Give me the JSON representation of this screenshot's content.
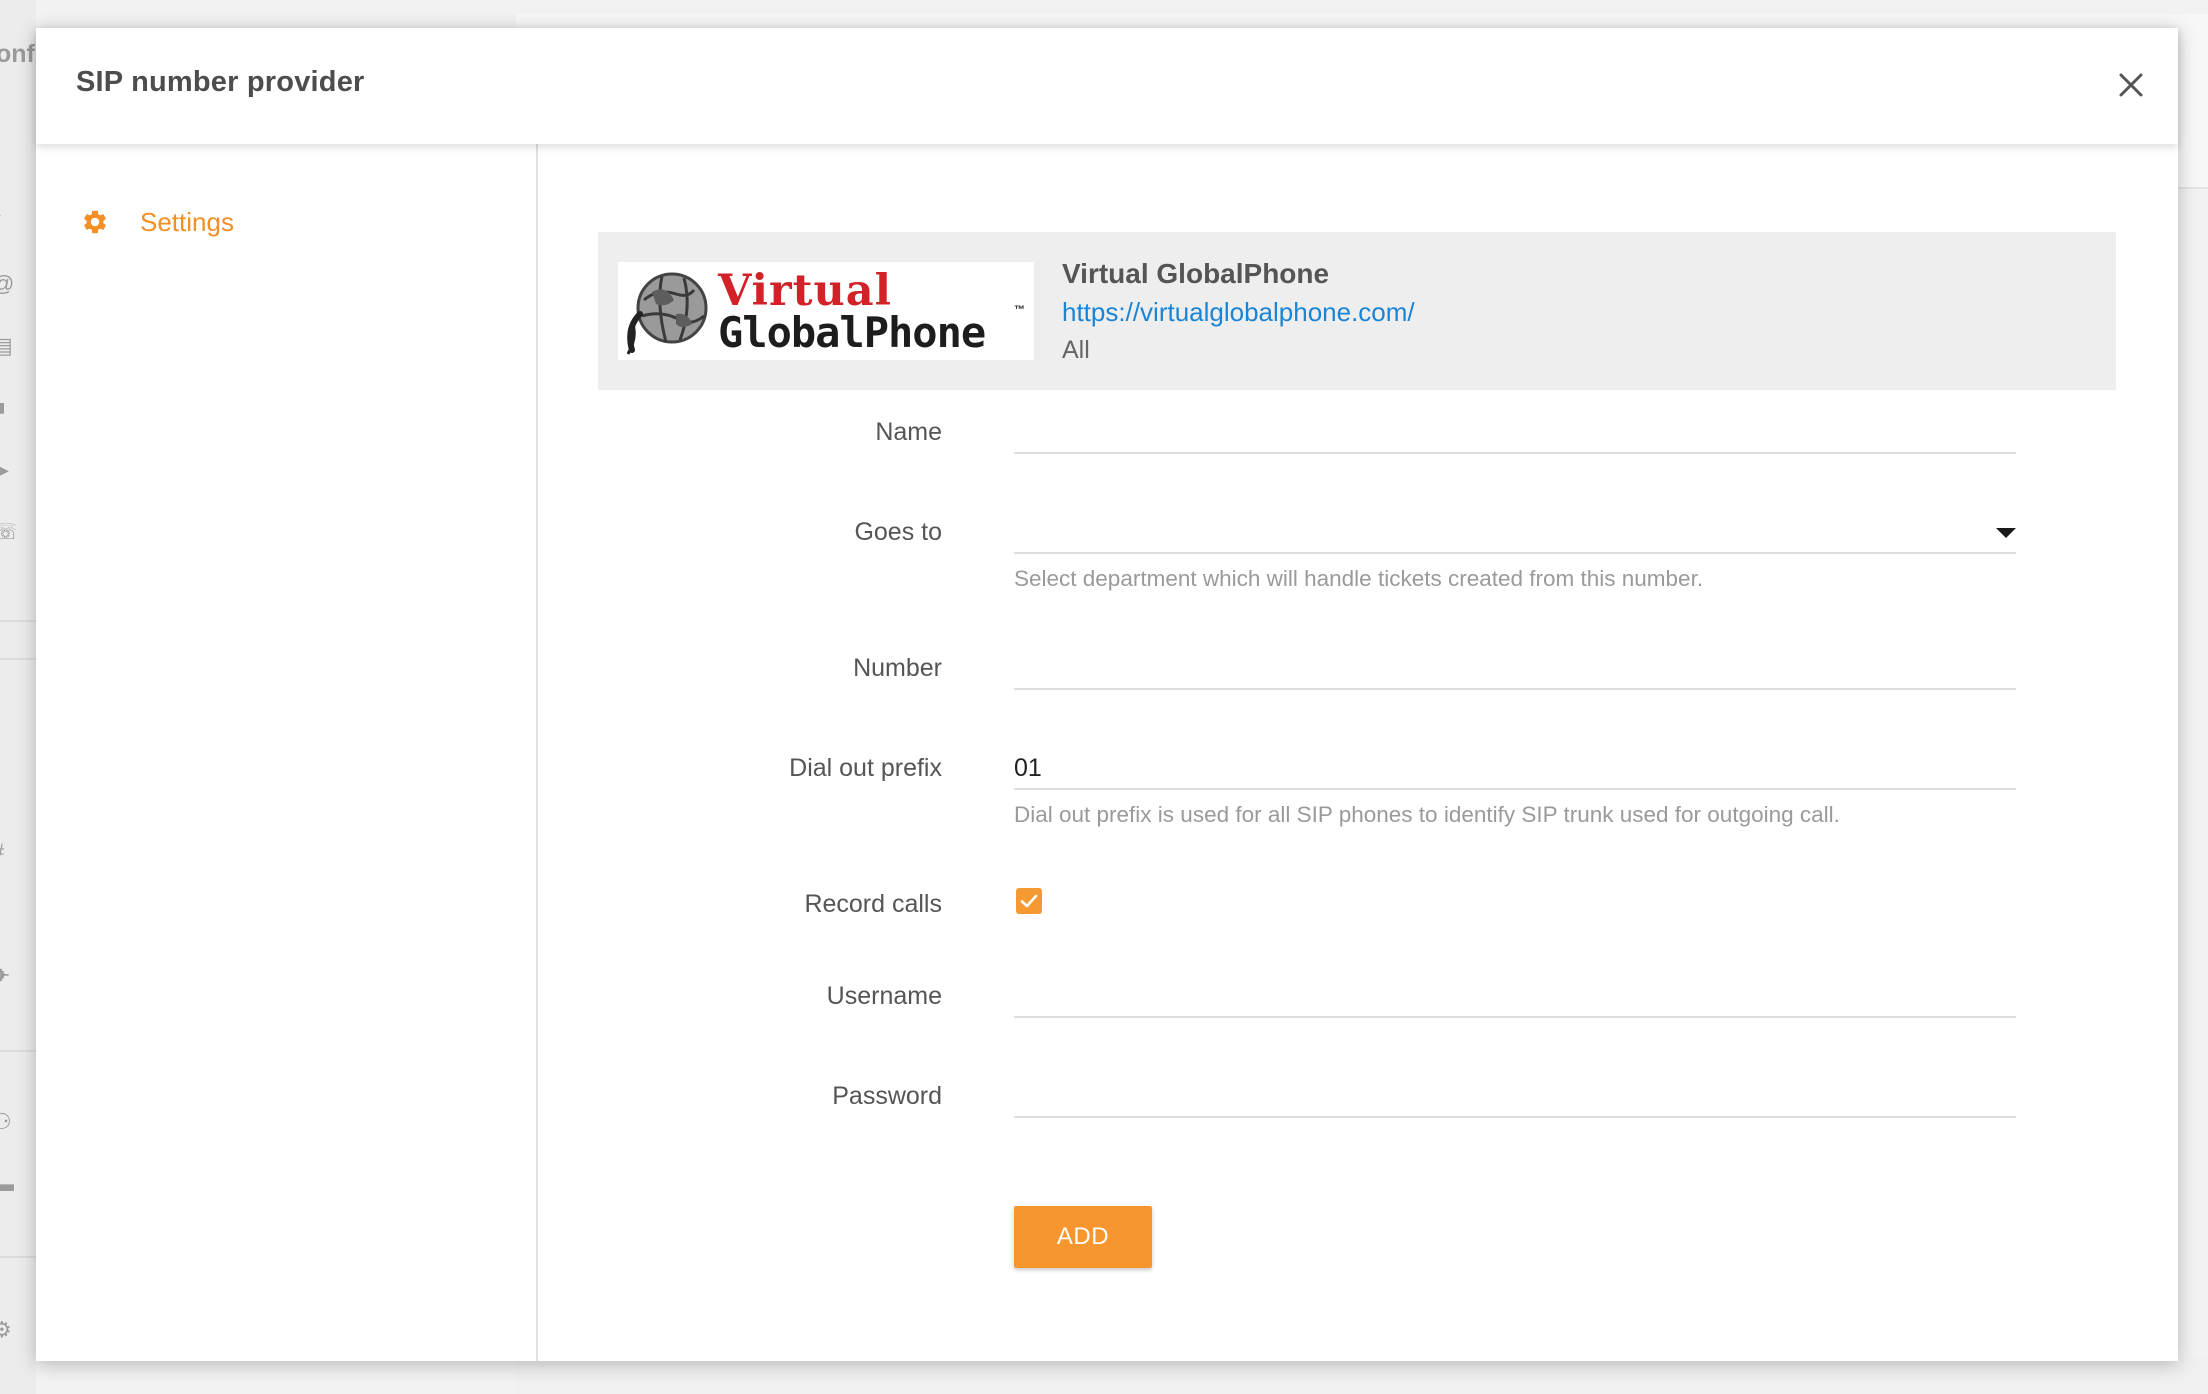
{
  "background": {
    "fragment_text": "onfi"
  },
  "modal": {
    "title": "SIP number provider",
    "close_icon": "close-icon"
  },
  "sidebar": {
    "items": [
      {
        "label": "Settings",
        "icon": "gear-icon",
        "active": true
      }
    ]
  },
  "provider": {
    "logo_line1": "Virtual",
    "logo_line2": "GlobalPhone",
    "logo_tm": "™",
    "name": "Virtual GlobalPhone",
    "url": "https://virtualglobalphone.com/",
    "scope": "All"
  },
  "form": {
    "name": {
      "label": "Name",
      "value": ""
    },
    "goes_to": {
      "label": "Goes to",
      "value": "",
      "hint": "Select department which will handle tickets created from this number."
    },
    "number": {
      "label": "Number",
      "value": ""
    },
    "dial_out_prefix": {
      "label": "Dial out prefix",
      "value": "01",
      "hint": "Dial out prefix is used for all SIP phones to identify SIP trunk used for outgoing call."
    },
    "record_calls": {
      "label": "Record calls",
      "checked": true
    },
    "username": {
      "label": "Username",
      "value": ""
    },
    "password": {
      "label": "Password",
      "value": ""
    },
    "submit_label": "ADD"
  },
  "colors": {
    "accent": "#f7962e",
    "link": "#1a84d6",
    "logo_red": "#d22228"
  }
}
